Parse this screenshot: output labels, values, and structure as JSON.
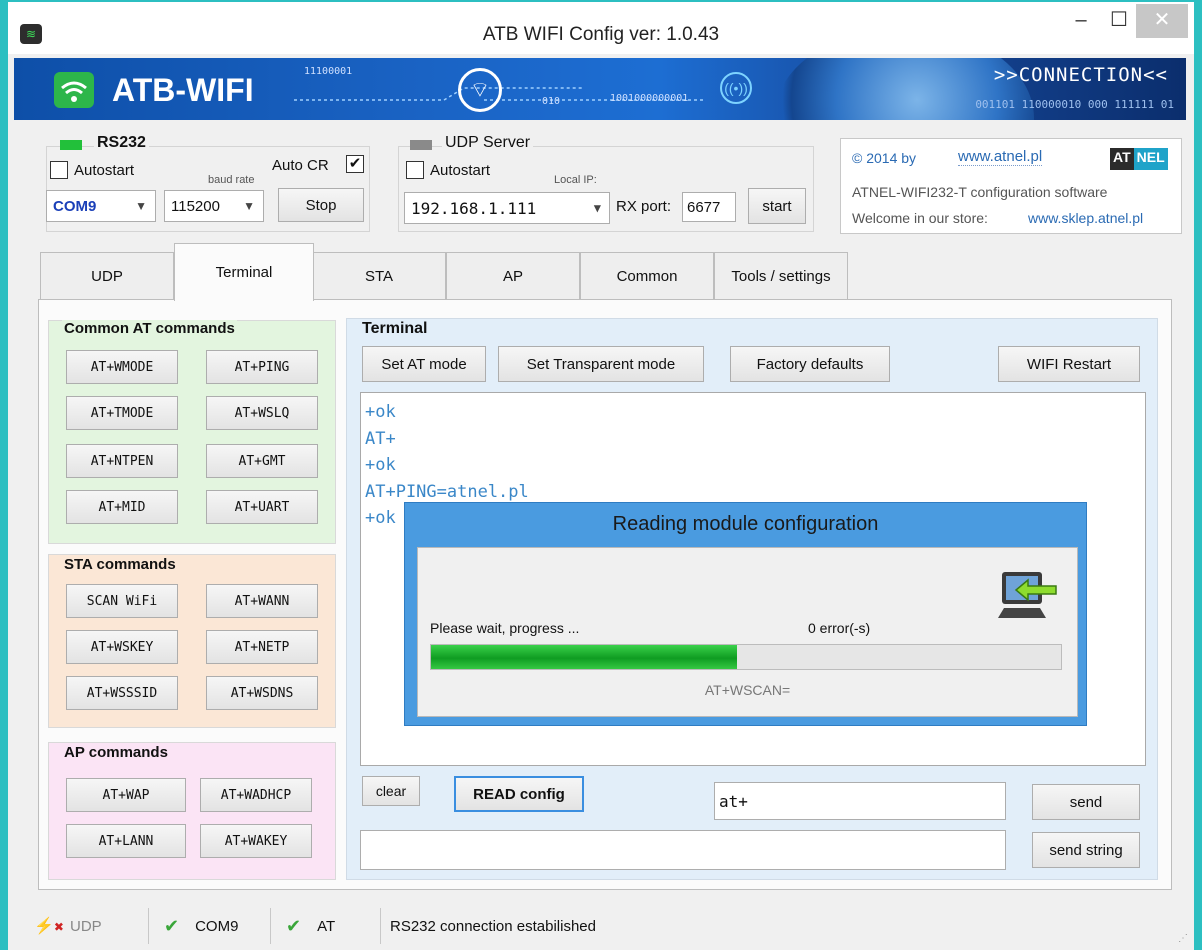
{
  "window": {
    "title": "ATB WIFI Config ver: 1.0.43"
  },
  "banner": {
    "brand": "ATB-WIFI",
    "bits_a": "11100001",
    "bits_b": "010",
    "bits_c": "1001000000001",
    "connection": ">>CONNECTION<<",
    "bits_d": "001101 110000010 000 111111 01"
  },
  "rs232": {
    "title": "RS232",
    "autostart_label": "Autostart",
    "autostart_checked": false,
    "baud_caption": "baud rate",
    "autocr_label": "Auto CR",
    "autocr_checked": true,
    "port": "COM9",
    "baud": "115200",
    "stop_label": "Stop"
  },
  "udp_server": {
    "title": "UDP Server",
    "autostart_label": "Autostart",
    "autostart_checked": false,
    "local_ip_caption": "Local IP:",
    "local_ip": "192.168.1.111",
    "rx_port_label": "RX port:",
    "rx_port": "6677",
    "start_label": "start"
  },
  "info": {
    "copyright": "© 2014 by",
    "link": "www.atnel.pl",
    "logo_a": "AT",
    "logo_b": "NEL",
    "line1": "ATNEL-WIFI232-T configuration software",
    "line2_label": "Welcome in our store:",
    "line2_link": "www.sklep.atnel.pl"
  },
  "tabs": [
    "UDP",
    "Terminal",
    "STA",
    "AP",
    "Common",
    "Tools / settings"
  ],
  "active_tab": "Terminal",
  "common_at": {
    "title": "Common AT commands",
    "buttons": [
      "AT+WMODE",
      "AT+PING",
      "AT+TMODE",
      "AT+WSLQ",
      "AT+NTPEN",
      "AT+GMT",
      "AT+MID",
      "AT+UART"
    ]
  },
  "sta_cmds": {
    "title": "STA commands",
    "buttons": [
      "SCAN WiFi",
      "AT+WANN",
      "AT+WSKEY",
      "AT+NETP",
      "AT+WSSSID",
      "AT+WSDNS"
    ]
  },
  "ap_cmds": {
    "title": "AP commands",
    "buttons": [
      "AT+WAP",
      "AT+WADHCP",
      "AT+LANN",
      "AT+WAKEY"
    ]
  },
  "terminal": {
    "title": "Terminal",
    "set_at": "Set AT mode",
    "set_transparent": "Set Transparent mode",
    "factory": "Factory defaults",
    "restart": "WIFI Restart",
    "lines": [
      "+ok",
      "AT+",
      "+ok",
      "AT+PING=atnel.pl",
      "+ok"
    ],
    "clear_label": "clear",
    "read_config_label": "READ config",
    "command_input": "at+",
    "send_label": "send",
    "string_input": "",
    "send_string_label": "send string"
  },
  "modal": {
    "title": "Reading module configuration",
    "wait_text": "Please wait, progress ...",
    "error_text": "0 error(-s)",
    "progress": 0.485,
    "current_cmd": "AT+WSCAN="
  },
  "status": {
    "udp": "UDP",
    "com": "COM9",
    "at": "AT",
    "message": "RS232 connection estabilished"
  },
  "colors": {
    "accent": "#2cbfc1",
    "terminal_text": "#3a87c8",
    "common_bg": "#e3f5df",
    "sta_bg": "#fbe7d6",
    "ap_bg": "#fbe4f5",
    "status_led_green": "#22c03a",
    "status_led_gray": "#8a8a8a"
  }
}
